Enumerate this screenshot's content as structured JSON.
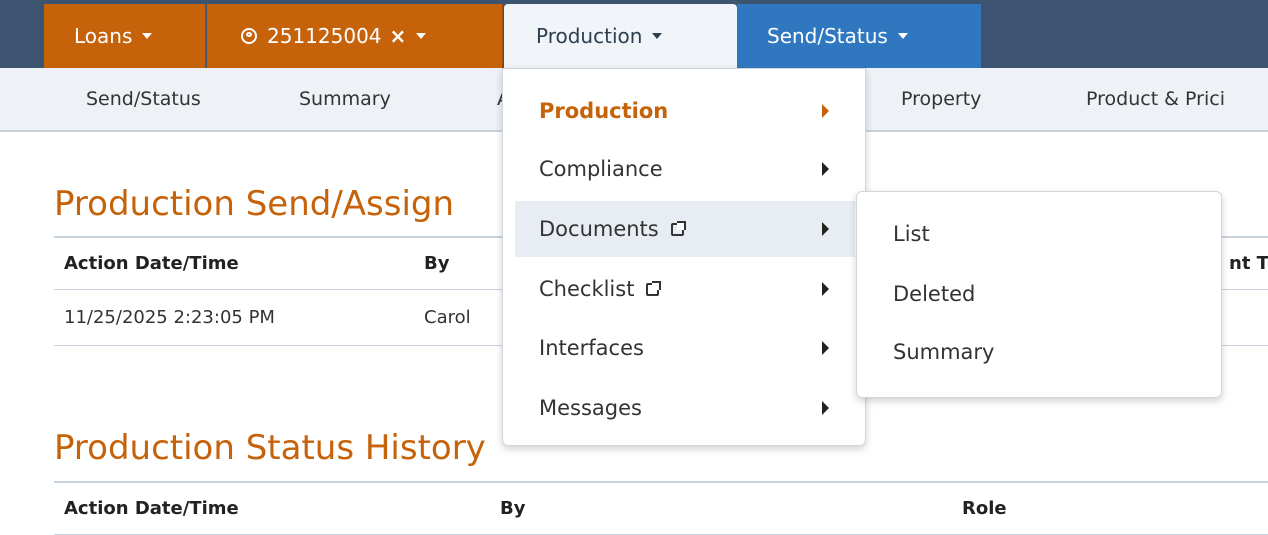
{
  "topnav": {
    "loans_label": "Loans",
    "loan_number": "251125004",
    "close_label": "×",
    "production_label": "Production",
    "send_status_label": "Send/Status"
  },
  "subnav": [
    "Send/Status",
    "Summary",
    "A",
    "Property",
    "Product & Prici"
  ],
  "sections": {
    "send_assign_title": "Production Send/Assign",
    "status_history_title": "Production Status History"
  },
  "table1": {
    "headers": [
      "Action Date/Time",
      "By",
      "nt T"
    ],
    "rows": [
      [
        "11/25/2025 2:23:05 PM",
        "Carol"
      ]
    ]
  },
  "table2": {
    "headers": [
      "Action Date/Time",
      "By",
      "Role"
    ]
  },
  "menu": {
    "items": [
      "Production",
      "Compliance",
      "Documents",
      "Checklist",
      "Interfaces",
      "Messages"
    ]
  },
  "submenu": {
    "items": [
      "List",
      "Deleted",
      "Summary"
    ]
  },
  "colors": {
    "accent": "#c5620a",
    "nav": "#3d5470",
    "blue": "#2f78c0"
  }
}
